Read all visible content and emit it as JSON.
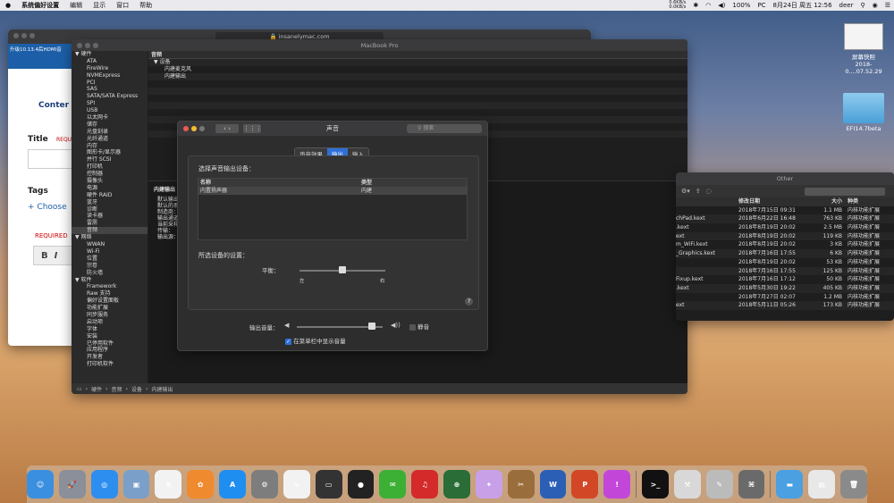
{
  "menubar": {
    "app": "系统偏好设置",
    "items": [
      "编辑",
      "显示",
      "窗口",
      "帮助"
    ],
    "net_up": "0.6KB/s",
    "net_down": "0.0KB/s",
    "battery": "100%",
    "input": "PC",
    "datetime": "8月24日 周五 12:56",
    "user": "deer"
  },
  "desktop": {
    "screenshot_label": "屏幕快照",
    "screenshot_name": "2018-0....07.52.29",
    "folder_label": "EFI14.7beta"
  },
  "browser": {
    "url": "insanelymac.com",
    "breadcrumb": "升级10.13.4后HDMI音",
    "content_label": "Conter",
    "title_label": "Title",
    "required": "REQUI",
    "tags_label": "Tags",
    "choose": "Choose",
    "required2": "REQUIRED",
    "bold_btn": "B",
    "italic_btn": "I"
  },
  "sysinfo": {
    "title": "MacBook Pro",
    "column": "音频",
    "tree": [
      "▼ 设备",
      "内建麦克风",
      "内建输出"
    ],
    "sidebar": [
      {
        "label": "▼ 硬件",
        "sec": true
      },
      {
        "label": "ATA"
      },
      {
        "label": "FireWire"
      },
      {
        "label": "NVMExpress"
      },
      {
        "label": "PCI"
      },
      {
        "label": "SAS"
      },
      {
        "label": "SATA/SATA Express"
      },
      {
        "label": "SPI"
      },
      {
        "label": "USB"
      },
      {
        "label": "以太网卡"
      },
      {
        "label": "储存"
      },
      {
        "label": "光盘刻录"
      },
      {
        "label": "光纤通道"
      },
      {
        "label": "内存"
      },
      {
        "label": "图形卡/显示器"
      },
      {
        "label": "并行 SCSI"
      },
      {
        "label": "打印机"
      },
      {
        "label": "控制器"
      },
      {
        "label": "摄像头"
      },
      {
        "label": "电源"
      },
      {
        "label": "硬件 RAID"
      },
      {
        "label": "蓝牙"
      },
      {
        "label": "诊断"
      },
      {
        "label": "读卡器"
      },
      {
        "label": "雷雳"
      },
      {
        "label": "音频",
        "sel": true
      },
      {
        "label": "▼ 网络",
        "sec": true
      },
      {
        "label": "WWAN"
      },
      {
        "label": "Wi-Fi"
      },
      {
        "label": "位置"
      },
      {
        "label": "宗卷"
      },
      {
        "label": "防火墙"
      },
      {
        "label": "▼ 软件",
        "sec": true
      },
      {
        "label": "Framework"
      },
      {
        "label": "Raw 支持"
      },
      {
        "label": "偏好设置面板"
      },
      {
        "label": "功能扩展"
      },
      {
        "label": "同步服务"
      },
      {
        "label": "启动项"
      },
      {
        "label": "字体"
      },
      {
        "label": "安装"
      },
      {
        "label": "已停用软件"
      },
      {
        "label": "应用程序"
      },
      {
        "label": "开发者"
      },
      {
        "label": "打印机软件"
      }
    ],
    "detail_title": "内建输出",
    "detail_lines": [
      "默认输出",
      "默认的系",
      "制造商：",
      "输出通道",
      "当前采样",
      "传输：",
      "输出源："
    ],
    "status": [
      "硬件",
      "音频",
      "设备",
      "内建输出"
    ]
  },
  "finder": {
    "title": "Other",
    "headers": [
      "修改日期",
      "大小",
      "种类"
    ],
    "rows": [
      [
        "",
        "2018年7月15日 09:31",
        "1.1 MB",
        "内核功能扩展"
      ],
      [
        "chPad.kext",
        "2018年6月22日 16:48",
        "763 KB",
        "内核功能扩展"
      ],
      [
        ".kext",
        "2018年8月19日 20:02",
        "2.5 MB",
        "内核功能扩展"
      ],
      [
        "ext",
        "2018年8月19日 20:02",
        "119 KB",
        "内核功能扩展"
      ],
      [
        "m_WiFi.kext",
        "2018年8月19日 20:02",
        "3 KB",
        "内核功能扩展"
      ],
      [
        "_Graphics.kext",
        "2018年7月16日 17:55",
        "6 KB",
        "内核功能扩展"
      ],
      [
        "",
        "2018年8月19日 20:02",
        "53 KB",
        "内核功能扩展"
      ],
      [
        "",
        "2018年7月16日 17:55",
        "125 KB",
        "内核功能扩展"
      ],
      [
        "Fixup.kext",
        "2018年7月16日 17:12",
        "50 KB",
        "内核功能扩展"
      ],
      [
        ".kext",
        "2018年5月30日 19:22",
        "405 KB",
        "内核功能扩展"
      ],
      [
        "",
        "2018年7月27日 02:07",
        "1.2 MB",
        "内核功能扩展"
      ],
      [
        "ext",
        "2018年5月11日 05:26",
        "173 KB",
        "内核功能扩展"
      ]
    ]
  },
  "sound": {
    "title": "声音",
    "search_placeholder": "搜索",
    "tabs": [
      "声音效果",
      "输出",
      "输入"
    ],
    "active_tab": 1,
    "choose_device": "选择声音输出设备：",
    "col_name": "名称",
    "col_type": "类型",
    "device_name": "内置扬声器",
    "device_type": "内建",
    "selected_settings": "所选设备的设置：",
    "balance_label": "平衡：",
    "left": "左",
    "right": "右",
    "balance_value": 0.5,
    "help": "?",
    "volume_label": "输出音量：",
    "volume_value": 0.88,
    "mute_label": "静音",
    "show_in_menubar": "在菜单栏中显示音量"
  },
  "dock": {
    "apps": [
      {
        "name": "finder-icon",
        "color": "#3b8fe0",
        "glyph": "☺"
      },
      {
        "name": "launchpad-icon",
        "color": "#8a8f99",
        "glyph": "🚀"
      },
      {
        "name": "safari-icon",
        "color": "#2d8ef0",
        "glyph": "◎"
      },
      {
        "name": "preview-icon",
        "color": "#7a9fc9",
        "glyph": "▣"
      },
      {
        "name": "reminders-icon",
        "color": "#f2f2f2",
        "glyph": "≡"
      },
      {
        "name": "photos-icon",
        "color": "#f08a2e",
        "glyph": "✿"
      },
      {
        "name": "appstore-icon",
        "color": "#1e8ef0",
        "glyph": "A"
      },
      {
        "name": "system-preferences-icon",
        "color": "#7d7d7d",
        "glyph": "⚙"
      },
      {
        "name": "baidunetdisk-icon",
        "color": "#f2f2f2",
        "glyph": "∞"
      },
      {
        "name": "monitor-icon",
        "color": "#333",
        "glyph": "▭"
      },
      {
        "name": "qq-icon",
        "color": "#222",
        "glyph": "●"
      },
      {
        "name": "wechat-icon",
        "color": "#3cb034",
        "glyph": "✉"
      },
      {
        "name": "netease-music-icon",
        "color": "#d42a2a",
        "glyph": "♫"
      },
      {
        "name": "globe-app-icon",
        "color": "#2a6d36",
        "glyph": "⊕"
      },
      {
        "name": "unicorn-icon",
        "color": "#c8a0e8",
        "glyph": "✦"
      },
      {
        "name": "utilities-icon",
        "color": "#9a6e3c",
        "glyph": "✂"
      },
      {
        "name": "word-icon",
        "color": "#2b5fb5",
        "glyph": "W"
      },
      {
        "name": "powerpoint-icon",
        "color": "#d24726",
        "glyph": "P"
      },
      {
        "name": "itunes-icon",
        "color": "#c247d8",
        "glyph": "!"
      },
      {
        "name": "terminal-icon",
        "color": "#111",
        "glyph": ">_"
      },
      {
        "name": "xcode-icon",
        "color": "#d8d8d8",
        "glyph": "⚒"
      },
      {
        "name": "script-editor-icon",
        "color": "#bbb",
        "glyph": "✎"
      },
      {
        "name": "dashboard-icon",
        "color": "#6a6a6a",
        "glyph": "⌘"
      },
      {
        "name": "downloads-folder-icon",
        "color": "#4aa0e0",
        "glyph": "▬"
      },
      {
        "name": "documents-icon",
        "color": "#e8e8e8",
        "glyph": "▤"
      },
      {
        "name": "trash-icon",
        "color": "#8a8a8a",
        "glyph": "🗑"
      }
    ]
  }
}
